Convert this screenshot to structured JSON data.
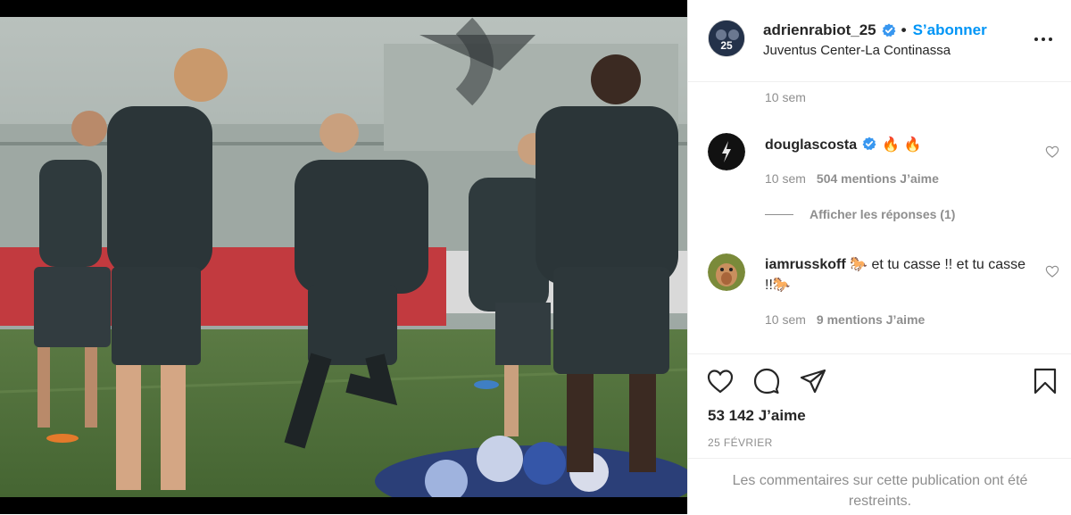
{
  "post": {
    "photo_description_icon": "training-photo",
    "header": {
      "username": "adrienrabiot_25",
      "verified_icon": "verified-badge-icon",
      "separator": "•",
      "follow_label": "S’abonner",
      "location": "Juventus Center-La Continassa",
      "avatar_text": "25",
      "more_icon": "more-options-icon"
    },
    "caption_meta": {
      "time": "10 sem"
    },
    "comments": [
      {
        "username": "douglascosta",
        "verified": true,
        "text": "🔥 🔥",
        "time": "10 sem",
        "likes": "504 mentions J’aime",
        "replies_label": "Afficher les réponses (1)"
      },
      {
        "username": "iamrusskoff",
        "text": "🐎 et tu casse !! et tu casse !!🐎",
        "time": "10 sem",
        "likes": "9 mentions J’aime"
      }
    ],
    "actions": {
      "like_icon": "heart-icon",
      "comment_icon": "comment-icon",
      "share_icon": "share-icon",
      "save_icon": "bookmark-icon"
    },
    "likes_count": "53 142 J’aime",
    "date": "25 FÉVRIER",
    "restricted_notice": "Les commentaires sur cette publication ont été restreints.",
    "colors": {
      "link": "#0095f6",
      "muted": "#8e8e8e",
      "text": "#262626",
      "border": "#efefef"
    }
  }
}
